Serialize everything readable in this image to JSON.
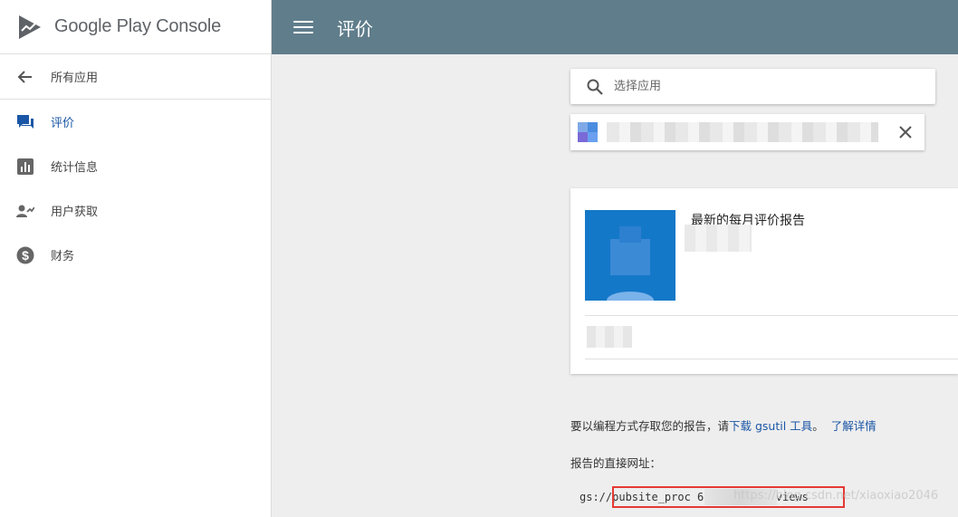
{
  "app": {
    "name": "Google Play Console"
  },
  "sidebar": {
    "back_label": "所有应用",
    "items": [
      {
        "label": "评价",
        "icon": "reviews-icon",
        "active": true
      },
      {
        "label": "统计信息",
        "icon": "stats-icon",
        "active": false
      },
      {
        "label": "用户获取",
        "icon": "user-acquisition-icon",
        "active": false
      },
      {
        "label": "财务",
        "icon": "finance-dollar-icon",
        "active": false
      }
    ]
  },
  "header": {
    "title": "评价"
  },
  "search": {
    "placeholder": "选择应用"
  },
  "report_card": {
    "title": "最新的每月评价报告"
  },
  "info": {
    "prefix": "要以编程方式存取您的报告，请",
    "download_link": "下载 gsutil 工具",
    "suffix": "。",
    "learn_more": "了解详情"
  },
  "direct_url": {
    "label": "报告的直接网址：",
    "value": "gs://pubsite_proc          678161150/reviews"
  },
  "watermark": "https://blog.csdn.net/xiaoxiao2046",
  "colors": {
    "topbar": "#607d8b",
    "accent_blue": "#1a56a6",
    "highlight_red": "#e53935",
    "thumb_blue": "#1478c8"
  }
}
